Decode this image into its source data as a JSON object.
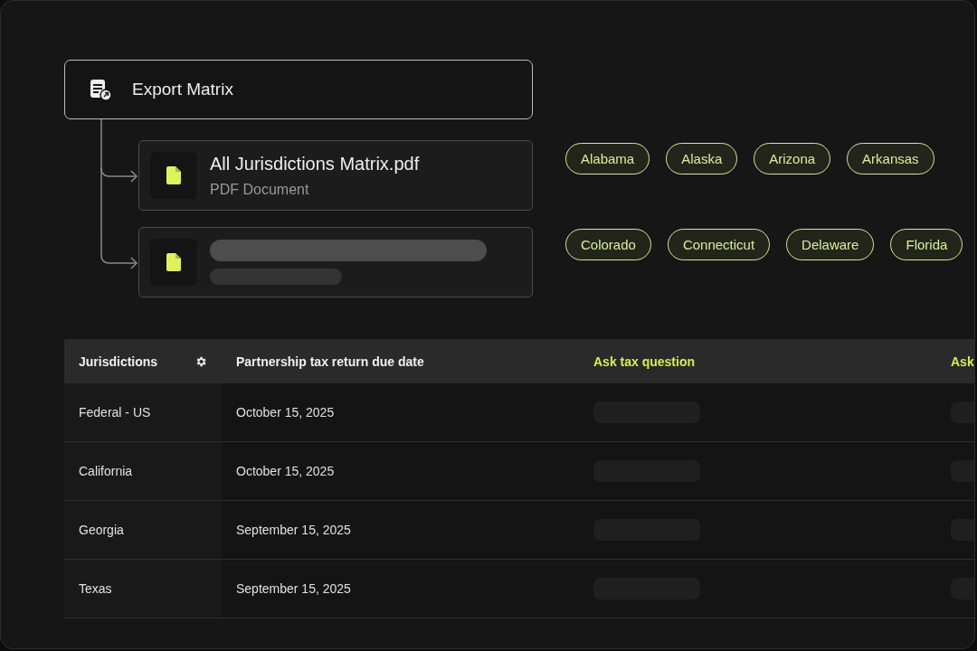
{
  "export": {
    "title": "Export Matrix"
  },
  "files": [
    {
      "kind": "file",
      "name": "All Jurisdictions Matrix.pdf",
      "type": "PDF Document"
    },
    {
      "kind": "loading"
    }
  ],
  "chips": [
    {
      "label": "Alabama"
    },
    {
      "label": "Alaska"
    },
    {
      "label": "Arizona"
    },
    {
      "label": "Arkansas"
    },
    {
      "label": "Colorado"
    },
    {
      "label": "Connecticut"
    },
    {
      "label": "Delaware"
    },
    {
      "label": "Florida"
    }
  ],
  "table": {
    "columns": [
      {
        "label": "Jurisdictions",
        "kind": "plain"
      },
      {
        "label": "Partnership tax return due date",
        "kind": "plain"
      },
      {
        "label": "Ask tax question",
        "kind": "action"
      },
      {
        "label": "Ask",
        "kind": "action"
      }
    ],
    "rows": [
      {
        "jurisdiction": "Federal - US",
        "due_date": "October 15, 2025"
      },
      {
        "jurisdiction": "California",
        "due_date": "October 15, 2025"
      },
      {
        "jurisdiction": "Georgia",
        "due_date": "September 15, 2025"
      },
      {
        "jurisdiction": "Texas",
        "due_date": "September 15, 2025"
      }
    ]
  }
}
